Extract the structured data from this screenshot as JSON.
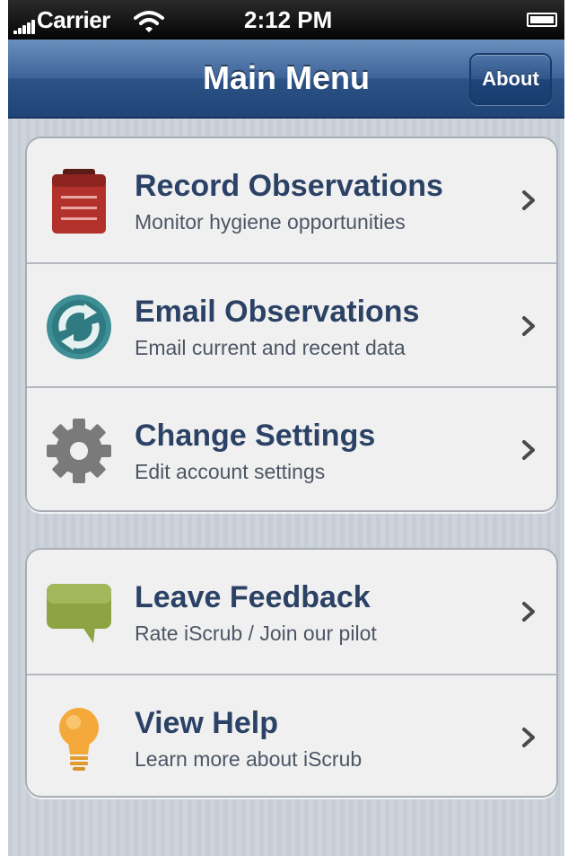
{
  "status_bar": {
    "carrier": "Carrier",
    "time": "2:12 PM",
    "signal_icon": "signal-bars-icon",
    "wifi_icon": "wifi-icon",
    "battery_icon": "battery-icon",
    "battery_level": 1.0
  },
  "nav_bar": {
    "title": "Main Menu",
    "about_label": "About"
  },
  "menu_groups": [
    {
      "items": [
        {
          "title": "Record Observations",
          "subtitle": "Monitor hygiene opportunities",
          "icon": "clipboard-icon",
          "icon_color": "#b3312b"
        },
        {
          "title": "Email Observations",
          "subtitle": "Email current and recent data",
          "icon": "sync-arrows-icon",
          "icon_color": "#3d8f95"
        },
        {
          "title": "Change Settings",
          "subtitle": "Edit account settings",
          "icon": "gear-icon",
          "icon_color": "#7a7a7a"
        }
      ]
    },
    {
      "items": [
        {
          "title": "Leave Feedback",
          "subtitle": "Rate iScrub / Join our pilot",
          "icon": "speech-bubble-icon",
          "icon_color": "#8ea444"
        },
        {
          "title": "View Help",
          "subtitle": "Learn more about iScrub",
          "icon": "lightbulb-icon",
          "icon_color": "#f4a93a"
        }
      ]
    }
  ],
  "colors": {
    "nav_bar": "#2c5286",
    "title_text": "#2b4266",
    "subtitle_text": "#4d5665",
    "background_stripes": "#c7cdd6"
  }
}
